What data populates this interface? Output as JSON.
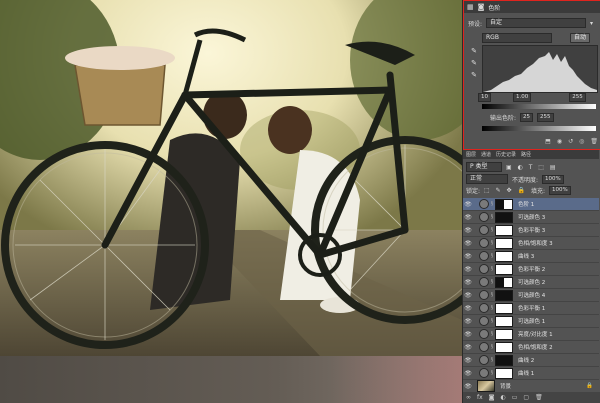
{
  "properties": {
    "tab_title": "色阶",
    "preset_label": "预设:",
    "preset_value": "自定",
    "channel_value": "RGB",
    "auto_button": "自动",
    "input_black": "10",
    "input_mid": "1.00",
    "input_white": "255",
    "output_label": "输出色阶:",
    "output_black": "25",
    "output_white": "255"
  },
  "layers": {
    "tabs": [
      "图层",
      "通道",
      "历史记录",
      "路径"
    ],
    "kind_label": "P 类型",
    "blend_mode": "正常",
    "opacity_label": "不透明度:",
    "opacity_value": "100%",
    "lock_label": "锁定:",
    "fill_label": "填充:",
    "fill_value": "100%",
    "items": [
      {
        "name": "色阶 1",
        "mask": "part",
        "active": true
      },
      {
        "name": "可选颜色 3",
        "mask": "dark"
      },
      {
        "name": "色彩平衡 3",
        "mask": "white"
      },
      {
        "name": "色相/饱和度 3",
        "mask": "white"
      },
      {
        "name": "曲线 3",
        "mask": "white"
      },
      {
        "name": "色彩平衡 2",
        "mask": "white"
      },
      {
        "name": "可选颜色 2",
        "mask": "part"
      },
      {
        "name": "可选颜色 4",
        "mask": "dark"
      },
      {
        "name": "色彩平衡 1",
        "mask": "white"
      },
      {
        "name": "可选颜色 1",
        "mask": "white"
      },
      {
        "name": "亮度/对比度 1",
        "mask": "white"
      },
      {
        "name": "色相/饱和度 2",
        "mask": "white"
      },
      {
        "name": "曲线 2",
        "mask": "dark"
      },
      {
        "name": "曲线 1",
        "mask": "white"
      },
      {
        "name": "背景",
        "mask": "none"
      }
    ]
  }
}
